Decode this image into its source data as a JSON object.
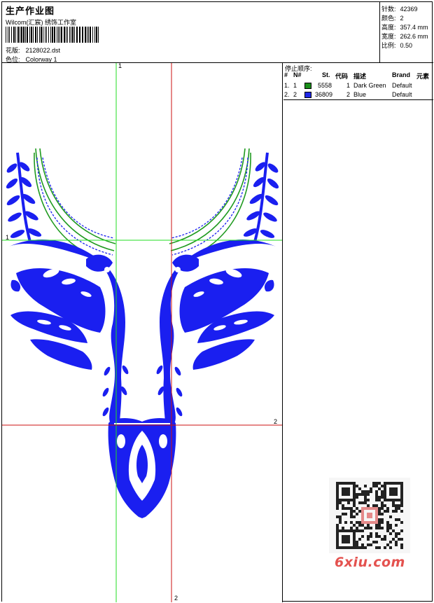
{
  "header": {
    "title": "生产作业图",
    "studio": "Wilcom(汇宸) 绣饰工作室",
    "design_label": "花版:",
    "design_file": "2128022.dst",
    "colorway_label": "色位:",
    "colorway": "Colorway 1"
  },
  "stats": [
    {
      "label": "针数:",
      "value": "42369"
    },
    {
      "label": "颜色:",
      "value": "2"
    },
    {
      "label": "高度:",
      "value": "357.4 mm"
    },
    {
      "label": "宽度:",
      "value": "262.6 mm"
    },
    {
      "label": "比例:",
      "value": "0.50"
    }
  ],
  "stop_sequence": {
    "title": "停止顺序:",
    "columns": [
      "#",
      "N#",
      "St.",
      "代码",
      "描述",
      "Brand",
      "元素"
    ],
    "rows": [
      {
        "num": "1.",
        "needle": "1",
        "stitches": "5558",
        "code": "1",
        "desc": "Dark Green",
        "brand": "Default",
        "color": "#1a8f1a"
      },
      {
        "num": "2.",
        "needle": "2",
        "stitches": "36809",
        "code": "2",
        "desc": "Blue",
        "brand": "Default",
        "color": "#1f28e6"
      }
    ]
  },
  "guides": {
    "v1": "1",
    "h1": "1",
    "h2": "2",
    "v2": "2"
  },
  "colors": {
    "blue_thread": "#1a1ff0",
    "green_thread": "#1f9a1f",
    "guide_green": "#22dd22",
    "guide_red": "#cc1111"
  },
  "watermark": "6xiu.com"
}
